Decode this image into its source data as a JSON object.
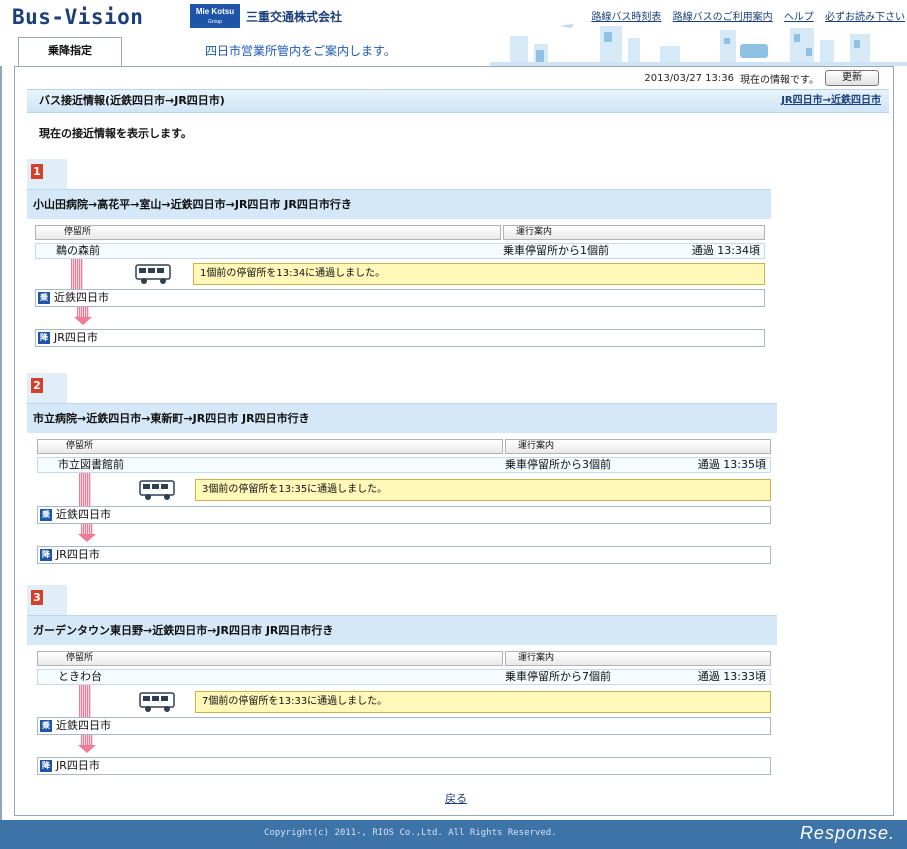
{
  "header": {
    "logo": "Bus-Vision",
    "badge_top": "Mie Kotsu",
    "badge_sub": "Group",
    "company": "三重交通株式会社",
    "links": [
      "路線バス時刻表",
      "路線バスのご利用案内",
      "ヘルプ",
      "必ずお読み下さい"
    ],
    "tab": "乗降指定",
    "guide": "四日市営業所管内をご案内します。"
  },
  "status": {
    "datetime": "2013/03/27 13:36",
    "info": "現在の情報です。",
    "refresh": "更新"
  },
  "section": {
    "title": "バス接近情報(近鉄四日市→JR四日市)",
    "reverse_link": "JR四日市→近鉄四日市",
    "intro": "現在の接近情報を表示します。"
  },
  "columns": {
    "stop": "停留所",
    "info": "運行案内"
  },
  "marks": {
    "board": "乗",
    "alight": "降"
  },
  "routes": [
    {
      "number": "1",
      "title": "小山田病院→高花平→室山→近鉄四日市→JR四日市 JR四日市行き",
      "current_stop": "鵜の森前",
      "operation": "乗車停留所から1個前",
      "pass_time": "通過 13:34頃",
      "notice": "1個前の停留所を13:34に通過しました。",
      "board_stop": "近鉄四日市",
      "alight_stop": "JR四日市"
    },
    {
      "number": "2",
      "title": "市立病院→近鉄四日市→東新町→JR四日市 JR四日市行き",
      "current_stop": "市立図書館前",
      "operation": "乗車停留所から3個前",
      "pass_time": "通過 13:35頃",
      "notice": "3個前の停留所を13:35に通過しました。",
      "board_stop": "近鉄四日市",
      "alight_stop": "JR四日市"
    },
    {
      "number": "3",
      "title": "ガーデンタウン東日野→近鉄四日市→JR四日市 JR四日市行き",
      "current_stop": "ときわ台",
      "operation": "乗車停留所から7個前",
      "pass_time": "通過 13:33頃",
      "notice": "7個前の停留所を13:33に通過しました。",
      "board_stop": "近鉄四日市",
      "alight_stop": "JR四日市"
    }
  ],
  "back": "戻る",
  "footer": {
    "copyright": "Copyright(c) 2011-, RIOS Co.,Ltd. All Rights Reserved.",
    "watermark": "Response."
  }
}
